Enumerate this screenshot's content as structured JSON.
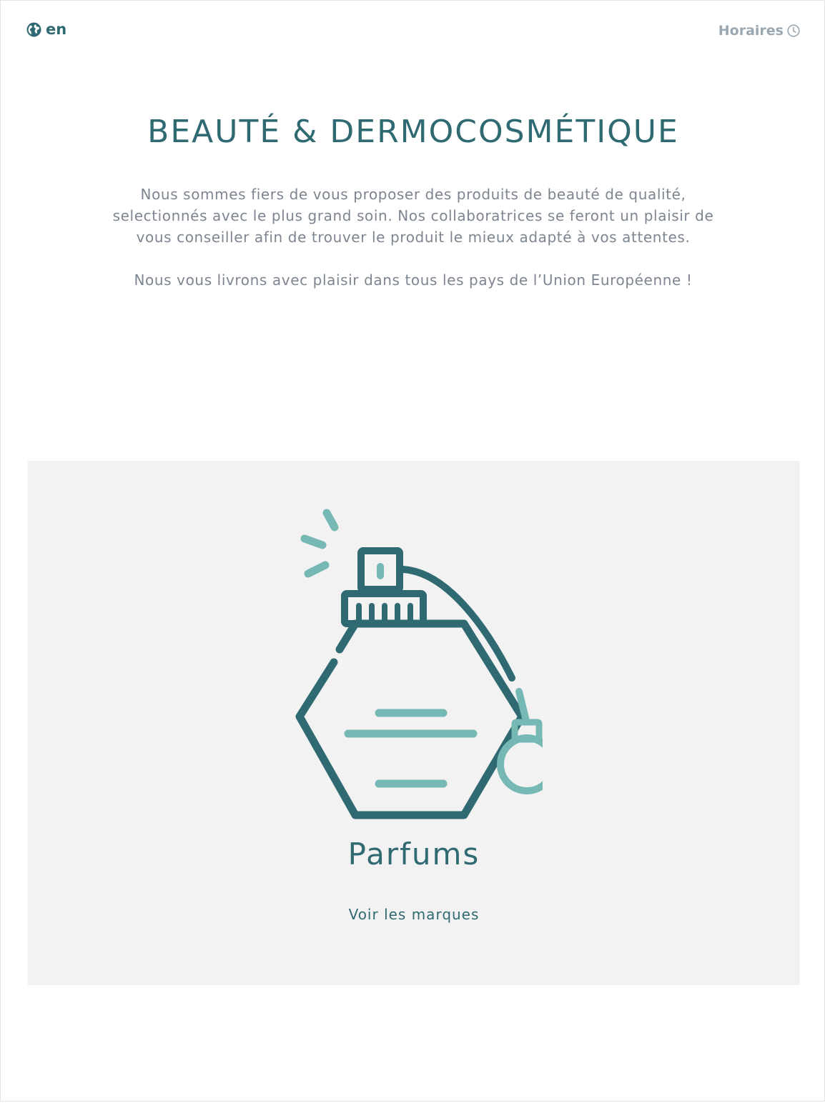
{
  "header": {
    "language_label": "en",
    "language_icon": "globe-icon",
    "hours_label": "Horaires",
    "hours_icon": "clock-icon"
  },
  "main": {
    "title": "BEAUTÉ & DERMOCOSMÉTIQUE",
    "intro_paragraphs": [
      "Nous sommes fiers de vous proposer des produits de beauté de qualité, selectionnés avec le plus grand soin. Nos collaboratrices se feront un plaisir de vous conseiller afin de trouver le produit le mieux adapté à vos attentes.",
      "Nous vous livrons avec plaisir dans tous les pays de l’Union Européenne !"
    ]
  },
  "category": {
    "icon": "perfume-bottle-icon",
    "title": "Parfums",
    "link_label": "Voir les marques"
  },
  "colors": {
    "primary": "#2f6a72",
    "accent": "#76b8b3",
    "muted_text": "#7d8591",
    "card_background": "#f2f2f2"
  }
}
